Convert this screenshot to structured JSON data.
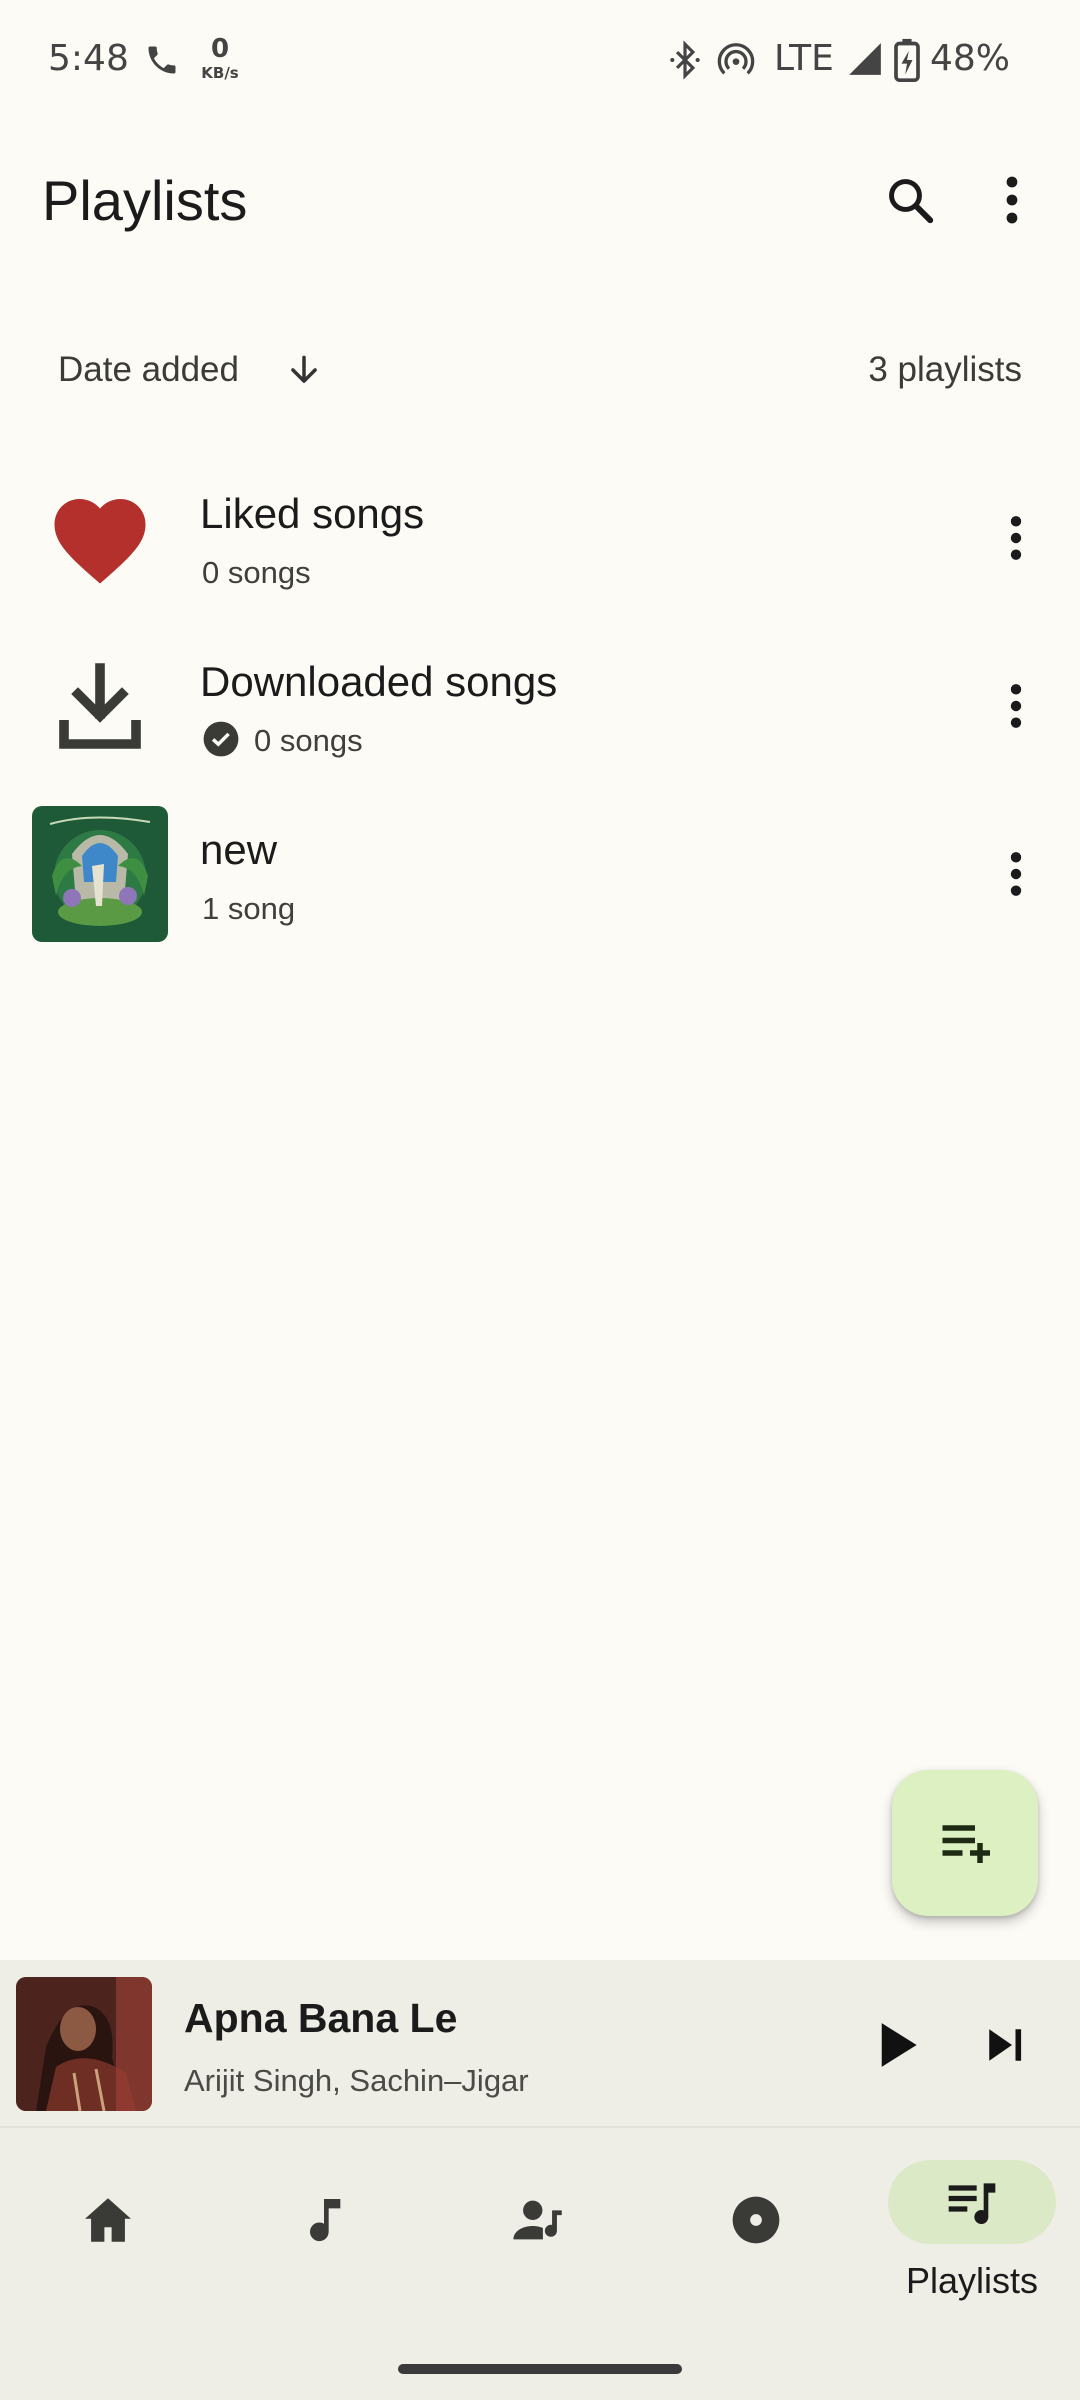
{
  "status_bar": {
    "time": "5:48",
    "net_speed_value": "0",
    "net_speed_unit": "KB/s",
    "network": "LTE",
    "battery": "48%",
    "icons": [
      "phone-icon",
      "bluetooth-icon",
      "hotspot-icon",
      "signal-icon",
      "battery-charging-icon"
    ]
  },
  "header": {
    "title": "Playlists",
    "icons": [
      "search-icon",
      "more-vert-icon"
    ]
  },
  "sort": {
    "label": "Date added",
    "direction_icon": "arrow-down-icon",
    "count": "3 playlists"
  },
  "playlists": [
    {
      "title": "Liked songs",
      "subtitle": "0 songs",
      "icon": "heart-icon"
    },
    {
      "title": "Downloaded songs",
      "subtitle": "0 songs",
      "icon": "download-icon",
      "badge_icon": "check-circle-icon"
    },
    {
      "title": "new",
      "subtitle": "1 song",
      "icon": "playlist-artwork"
    }
  ],
  "fab": {
    "icon": "playlist-add-icon"
  },
  "now_playing": {
    "title": "Apna Bana Le",
    "artist": "Arijit Singh, Sachin–Jigar",
    "icons": [
      "play-icon",
      "skip-next-icon"
    ]
  },
  "bottom_nav": {
    "items": [
      {
        "name": "home",
        "icon": "home-icon"
      },
      {
        "name": "songs",
        "icon": "music-note-icon"
      },
      {
        "name": "artists",
        "icon": "artist-icon"
      },
      {
        "name": "albums",
        "icon": "album-icon"
      },
      {
        "name": "playlists",
        "icon": "playlist-icon",
        "label": "Playlists",
        "active": true
      }
    ]
  },
  "colors": {
    "background": "#FCFBF6",
    "heart": "#B3302D",
    "fab": "#DCF0C2",
    "nav_active": "#DCE9C6",
    "bar": "#EEEEE6"
  }
}
